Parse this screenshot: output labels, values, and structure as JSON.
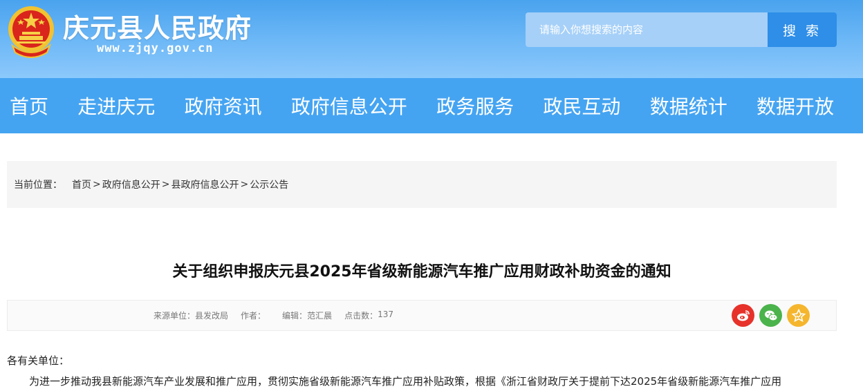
{
  "header": {
    "site_title": "庆元县人民政府",
    "site_domain": "www.zjqy.gov.cn",
    "emblem_icon": "national-emblem-icon",
    "colors": {
      "header_top": "#4aa3ee",
      "header_bottom": "#8cc8fb",
      "nav": "#45a4f2",
      "search_button": "#2e8ee8"
    }
  },
  "search": {
    "placeholder": "请输入你想搜索的内容",
    "button_label": "搜 索"
  },
  "nav": {
    "items": [
      {
        "label": "首页"
      },
      {
        "label": "走进庆元"
      },
      {
        "label": "政府资讯"
      },
      {
        "label": "政府信息公开"
      },
      {
        "label": "政务服务"
      },
      {
        "label": "政民互动"
      },
      {
        "label": "数据统计"
      },
      {
        "label": "数据开放"
      }
    ]
  },
  "breadcrumb": {
    "label": "当前位置：",
    "items": [
      "首页",
      "政府信息公开",
      "县政府信息公开",
      "公示公告"
    ],
    "separators": [
      " > ",
      "> ",
      "> "
    ]
  },
  "article": {
    "title": "关于组织申报庆元县2025年省级新能源汽车推广应用财政补助资金的通知",
    "meta": {
      "source_label": "来源单位：",
      "source_value": "县发改局",
      "author_label": "作者：",
      "author_value": "",
      "editor_label": "编辑：",
      "editor_value": "范汇晨",
      "clicks_label": "点击数：",
      "clicks_value": "137"
    },
    "share": {
      "weibo_icon": "weibo-icon",
      "wechat_icon": "wechat-icon",
      "favorite_icon": "star-icon",
      "colors": {
        "weibo": "#e6322a",
        "wechat": "#4bb34b",
        "favorite": "#f5b62e"
      }
    },
    "greeting": "各有关单位：",
    "paragraph_1": "为进一步推动我县新能源汽车产业发展和推广应用，贯彻实施省级新能源汽车推广应用补贴政策，根据《浙江省财政厅关于提前下达2025年省级新能源汽车推广应用"
  }
}
